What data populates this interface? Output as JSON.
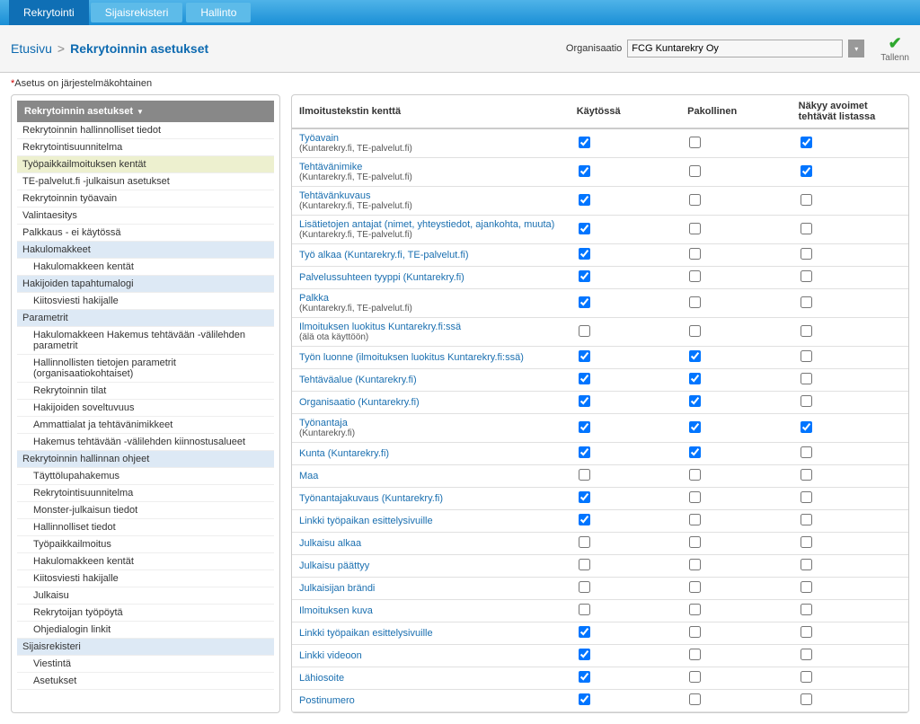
{
  "topnav": {
    "items": [
      {
        "label": "Rekrytointi",
        "active": true
      },
      {
        "label": "Sijaisrekisteri",
        "active": false
      },
      {
        "label": "Hallinto",
        "active": false
      }
    ]
  },
  "breadcrumb": {
    "home": "Etusivu",
    "sep": ">",
    "current": "Rekrytoinnin asetukset"
  },
  "org_label": "Organisaatio",
  "org_value": "FCG Kuntarekry Oy",
  "save_label": "Tallenn",
  "note_star": "*",
  "note_text": "Asetus on järjestelmäkohtainen",
  "sidebar": {
    "header": "Rekrytoinnin asetukset",
    "items": [
      {
        "label": "Rekrytoinnin hallinnolliset tiedot",
        "sub": false,
        "cls": ""
      },
      {
        "label": "Rekrytointisuunnitelma",
        "sub": false,
        "cls": ""
      },
      {
        "label": "Työpaikkailmoituksen kentät",
        "sub": false,
        "cls": "green"
      },
      {
        "label": "TE-palvelut.fi -julkaisun asetukset",
        "sub": false,
        "cls": ""
      },
      {
        "label": "Rekrytoinnin työavain",
        "sub": false,
        "cls": ""
      },
      {
        "label": "Valintaesitys",
        "sub": false,
        "cls": ""
      },
      {
        "label": "Palkkaus - ei käytössä",
        "sub": false,
        "cls": ""
      },
      {
        "label": "Hakulomakkeet",
        "sub": false,
        "cls": "blue"
      },
      {
        "label": "Hakulomakkeen kentät",
        "sub": true,
        "cls": ""
      },
      {
        "label": "Hakijoiden tapahtumalogi",
        "sub": false,
        "cls": "blue"
      },
      {
        "label": "Kiitosviesti hakijalle",
        "sub": true,
        "cls": ""
      },
      {
        "label": "Parametrit",
        "sub": false,
        "cls": "blue"
      },
      {
        "label": "Hakulomakkeen Hakemus tehtävään -välilehden parametrit",
        "sub": true,
        "cls": ""
      },
      {
        "label": "Hallinnollisten tietojen parametrit (organisaatiokohtaiset)",
        "sub": true,
        "cls": ""
      },
      {
        "label": "Rekrytoinnin tilat",
        "sub": true,
        "cls": ""
      },
      {
        "label": "Hakijoiden soveltuvuus",
        "sub": true,
        "cls": ""
      },
      {
        "label": "Ammattialat ja tehtävänimikkeet",
        "sub": true,
        "cls": ""
      },
      {
        "label": "Hakemus tehtävään -välilehden kiinnostusalueet",
        "sub": true,
        "cls": ""
      },
      {
        "label": "Rekrytoinnin hallinnan ohjeet",
        "sub": false,
        "cls": "blue"
      },
      {
        "label": "Täyttölupahakemus",
        "sub": true,
        "cls": ""
      },
      {
        "label": "Rekrytointisuunnitelma",
        "sub": true,
        "cls": ""
      },
      {
        "label": "Monster-julkaisun tiedot",
        "sub": true,
        "cls": ""
      },
      {
        "label": "Hallinnolliset tiedot",
        "sub": true,
        "cls": ""
      },
      {
        "label": "Työpaikkailmoitus",
        "sub": true,
        "cls": ""
      },
      {
        "label": "Hakulomakkeen kentät",
        "sub": true,
        "cls": ""
      },
      {
        "label": "Kiitosviesti hakijalle",
        "sub": true,
        "cls": ""
      },
      {
        "label": "Julkaisu",
        "sub": true,
        "cls": ""
      },
      {
        "label": "Rekrytoijan työpöytä",
        "sub": true,
        "cls": ""
      },
      {
        "label": "Ohjedialogin linkit",
        "sub": true,
        "cls": ""
      },
      {
        "label": "Sijaisrekisteri",
        "sub": false,
        "cls": "blue"
      },
      {
        "label": "Viestintä",
        "sub": true,
        "cls": ""
      },
      {
        "label": "Asetukset",
        "sub": true,
        "cls": ""
      }
    ]
  },
  "table": {
    "headers": [
      "Ilmoitustekstin kenttä",
      "Käytössä",
      "Pakollinen",
      "Näkyy avoimet tehtävät listassa"
    ],
    "rows": [
      {
        "title": "Työavain",
        "sub": "(Kuntarekry.fi, TE-palvelut.fi)",
        "c1": true,
        "c2": false,
        "c3": true
      },
      {
        "title": "Tehtävänimike",
        "sub": "(Kuntarekry.fi, TE-palvelut.fi)",
        "c1": true,
        "c2": false,
        "c3": true
      },
      {
        "title": "Tehtävänkuvaus",
        "sub": "(Kuntarekry.fi, TE-palvelut.fi)",
        "c1": true,
        "c2": false,
        "c3": false
      },
      {
        "title": "Lisätietojen antajat (nimet, yhteystiedot, ajankohta, muuta)",
        "sub": "(Kuntarekry.fi, TE-palvelut.fi)",
        "c1": true,
        "c2": false,
        "c3": false
      },
      {
        "title": "Työ alkaa (Kuntarekry.fi, TE-palvelut.fi)",
        "sub": "",
        "c1": true,
        "c2": false,
        "c3": false
      },
      {
        "title": "Palvelussuhteen tyyppi (Kuntarekry.fi)",
        "sub": "",
        "c1": true,
        "c2": false,
        "c3": false
      },
      {
        "title": "Palkka",
        "sub": "(Kuntarekry.fi, TE-palvelut.fi)",
        "c1": true,
        "c2": false,
        "c3": false
      },
      {
        "title": "Ilmoituksen luokitus Kuntarekry.fi:ssä",
        "sub": "(älä ota käyttöön)",
        "c1": false,
        "c2": false,
        "c3": false
      },
      {
        "title": "Työn luonne (ilmoituksen luokitus Kuntarekry.fi:ssä)",
        "sub": "",
        "c1": true,
        "c2": true,
        "c3": false
      },
      {
        "title": "Tehtäväalue (Kuntarekry.fi)",
        "sub": "",
        "c1": true,
        "c2": true,
        "c3": false
      },
      {
        "title": "Organisaatio (Kuntarekry.fi)",
        "sub": "",
        "c1": true,
        "c2": true,
        "c3": false
      },
      {
        "title": "Työnantaja",
        "sub": "(Kuntarekry.fi)",
        "c1": true,
        "c2": true,
        "c3": true
      },
      {
        "title": "Kunta (Kuntarekry.fi)",
        "sub": "",
        "c1": true,
        "c2": true,
        "c3": false
      },
      {
        "title": "Maa",
        "sub": "",
        "c1": false,
        "c2": false,
        "c3": false
      },
      {
        "title": "Työnantajakuvaus (Kuntarekry.fi)",
        "sub": "",
        "c1": true,
        "c2": false,
        "c3": false
      },
      {
        "title": "Linkki työpaikan esittelysivuille",
        "sub": "",
        "c1": true,
        "c2": false,
        "c3": false
      },
      {
        "title": "Julkaisu alkaa",
        "sub": "",
        "c1": false,
        "c2": false,
        "c3": false
      },
      {
        "title": "Julkaisu päättyy",
        "sub": "",
        "c1": false,
        "c2": false,
        "c3": false
      },
      {
        "title": "Julkaisijan brändi",
        "sub": "",
        "c1": false,
        "c2": false,
        "c3": false
      },
      {
        "title": "Ilmoituksen kuva",
        "sub": "",
        "c1": false,
        "c2": false,
        "c3": false
      },
      {
        "title": "Linkki työpaikan esittelysivuille",
        "sub": "",
        "c1": true,
        "c2": false,
        "c3": false
      },
      {
        "title": "Linkki videoon",
        "sub": "",
        "c1": true,
        "c2": false,
        "c3": false
      },
      {
        "title": "Lähiosoite",
        "sub": "",
        "c1": true,
        "c2": false,
        "c3": false
      },
      {
        "title": "Postinumero",
        "sub": "",
        "c1": true,
        "c2": false,
        "c3": false
      }
    ]
  }
}
